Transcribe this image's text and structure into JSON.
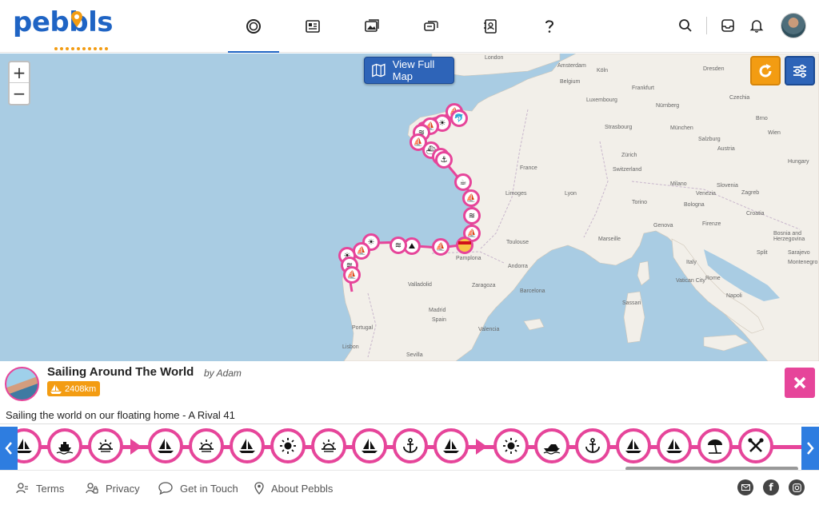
{
  "header": {
    "logo": "pebbls",
    "nav": [
      {
        "icon": "circle-target-icon",
        "active": true
      },
      {
        "icon": "newspaper-icon",
        "active": false
      },
      {
        "icon": "photo-gallery-icon",
        "active": false
      },
      {
        "icon": "chat-bubbles-icon",
        "active": false
      },
      {
        "icon": "contact-card-icon",
        "active": false
      },
      {
        "icon": "question-icon",
        "active": false
      }
    ]
  },
  "map": {
    "zoom_in": "+",
    "zoom_out": "−",
    "view_full_map": "View Full Map",
    "labels": {
      "london": "London",
      "amsterdam": "Amsterdam",
      "dresden": "Dresden",
      "belgium": "Belgium",
      "luxembourg": "Luxembourg",
      "czechia": "Czechia",
      "france": "France",
      "switzerland": "Switzerland",
      "austria": "Austria",
      "hungary": "Hungary",
      "slovenia": "Slovenia",
      "croatia": "Croatia",
      "italy": "Italy",
      "spain": "Spain",
      "portugal": "Portugal",
      "andorra": "Andorra",
      "madrid": "Madrid",
      "barcelona": "Barcelona",
      "valencia": "Valencia",
      "toulouse": "Toulouse",
      "lyon": "Lyon",
      "marseille": "Marseille",
      "genova": "Genova",
      "rome": "Rome",
      "vatican": "Vatican City",
      "sassari": "Sassari",
      "lisbon": "Lisbon",
      "zaragoza": "Zaragoza",
      "valladolid": "Valladolid",
      "pamplona": "Pamplona",
      "munich": "München",
      "zurich": "Zürich",
      "strasbourg": "Strasbourg",
      "frankfurt": "Frankfurt",
      "koln": "Köln",
      "nurnberg": "Nürnberg",
      "bosnia": "Bosnia and Herzegovina",
      "montenegro": "Montenegro",
      "milano": "Milano",
      "venezia": "Venezia",
      "bologna": "Bologna",
      "firenze": "Firenze",
      "torino": "Torino",
      "napoli": "Napoli",
      "limoges": "Limoges",
      "brno": "Brno",
      "wien": "Wien",
      "salzburg": "Salzburg",
      "zagreb": "Zagreb",
      "split": "Split",
      "sarajevo": "Sarajevo",
      "sevilla": "Sevilla"
    }
  },
  "trip": {
    "title": "Sailing Around The World",
    "by": "by Adam",
    "distance": "2408km",
    "description": "Sailing the world on our floating home - A Rival 41"
  },
  "timeline": [
    "sailboat-icon",
    "ship-icon",
    "sunrise-icon",
    "arrow",
    "sailboat-icon",
    "sunrise-icon",
    "sailboat-icon",
    "sun-icon",
    "sunrise-icon",
    "sailboat-icon",
    "anchor-icon",
    "sailboat-icon",
    "arrow",
    "sun-icon",
    "speedboat-icon",
    "anchor-icon",
    "sailboat-icon",
    "sailboat-icon",
    "beach-umbrella-icon",
    "tools-icon"
  ],
  "footer": {
    "terms": "Terms",
    "privacy": "Privacy",
    "contact": "Get in Touch",
    "about": "About Pebbls"
  },
  "colors": {
    "brand_blue": "#1f64c4",
    "accent_pink": "#e6459a",
    "accent_orange": "#f39c12",
    "button_blue": "#2e64b8",
    "sea": "#a9cce3",
    "land": "#f2efe9"
  }
}
